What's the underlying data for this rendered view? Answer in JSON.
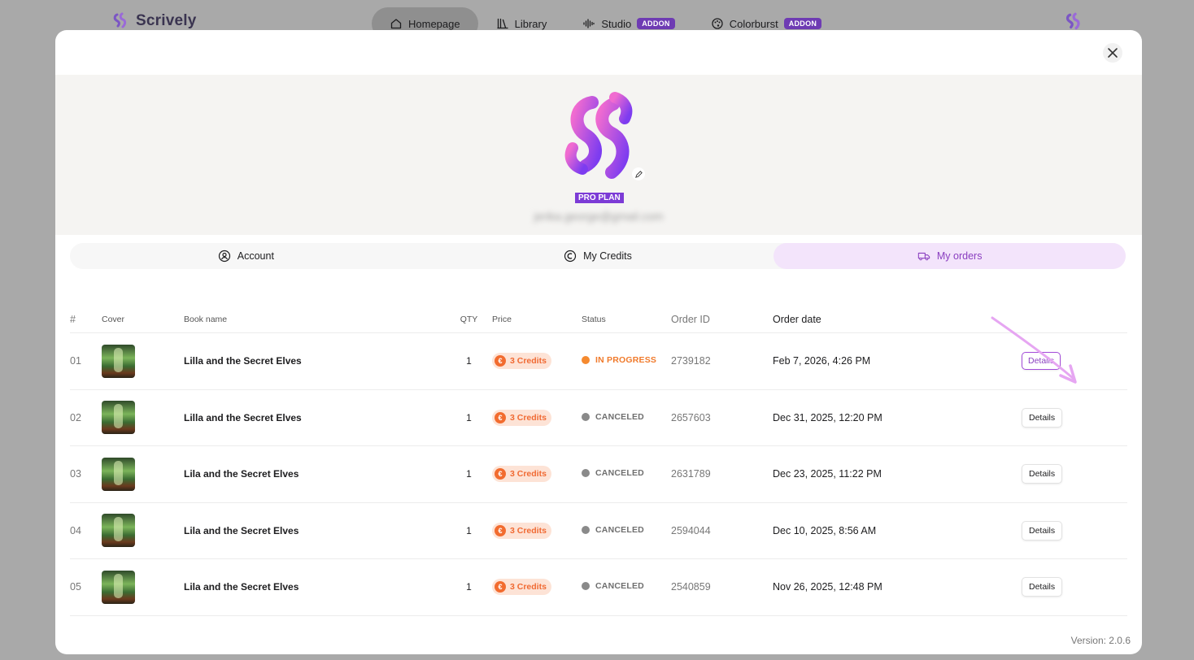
{
  "brand": {
    "name": "Scrively",
    "logo_icon": "scrively-logo-icon"
  },
  "nav": {
    "tabs": [
      {
        "label": "Homepage",
        "icon": "home-icon",
        "active": true,
        "badge": ""
      },
      {
        "label": "Library",
        "icon": "books-icon",
        "active": false,
        "badge": ""
      },
      {
        "label": "Studio",
        "icon": "audio-wave-icon",
        "active": false,
        "badge": "ADDON"
      },
      {
        "label": "Colorburst",
        "icon": "palette-icon",
        "active": false,
        "badge": "ADDON"
      }
    ]
  },
  "profile": {
    "plan": "PRO PLAN",
    "email": "jerika.george@gmail.com"
  },
  "tabs": [
    {
      "label": "Account",
      "icon": "user-circle-icon",
      "active": false
    },
    {
      "label": "My Credits",
      "icon": "credits-icon",
      "active": false
    },
    {
      "label": "My orders",
      "icon": "truck-icon",
      "active": true
    }
  ],
  "table": {
    "headers": {
      "num": "#",
      "cover": "Cover",
      "name": "Book name",
      "qty": "QTY",
      "price": "Price",
      "status": "Status",
      "order_id": "Order ID",
      "date": "Order date"
    },
    "rows": [
      {
        "num": "01",
        "name": "Lilla and the Secret Elves",
        "qty": "1",
        "price": "3 Credits",
        "status": "IN PROGRESS",
        "status_kind": "progress",
        "order_id": "2739182",
        "date": "Feb 7, 2026, 4:26 PM",
        "action": "Details"
      },
      {
        "num": "02",
        "name": "Lilla and the Secret Elves",
        "qty": "1",
        "price": "3 Credits",
        "status": "CANCELED",
        "status_kind": "canceled",
        "order_id": "2657603",
        "date": "Dec 31, 2025, 12:20 PM",
        "action": "Details"
      },
      {
        "num": "03",
        "name": "Lila and the Secret Elves",
        "qty": "1",
        "price": "3 Credits",
        "status": "CANCELED",
        "status_kind": "canceled",
        "order_id": "2631789",
        "date": "Dec 23, 2025, 11:22 PM",
        "action": "Details"
      },
      {
        "num": "04",
        "name": "Lila and the Secret Elves",
        "qty": "1",
        "price": "3 Credits",
        "status": "CANCELED",
        "status_kind": "canceled",
        "order_id": "2594044",
        "date": "Dec 10, 2025, 8:56 AM",
        "action": "Details"
      },
      {
        "num": "05",
        "name": "Lila and the Secret Elves",
        "qty": "1",
        "price": "3 Credits",
        "status": "CANCELED",
        "status_kind": "canceled",
        "order_id": "2540859",
        "date": "Nov 26, 2025, 12:48 PM",
        "action": "Details"
      }
    ]
  },
  "colors": {
    "accent": "#8a3fc0",
    "progress": "#f07a2b",
    "canceled": "#8a8a8a",
    "credits_bg": "#fde3d6"
  },
  "version": "Version: 2.0.6"
}
